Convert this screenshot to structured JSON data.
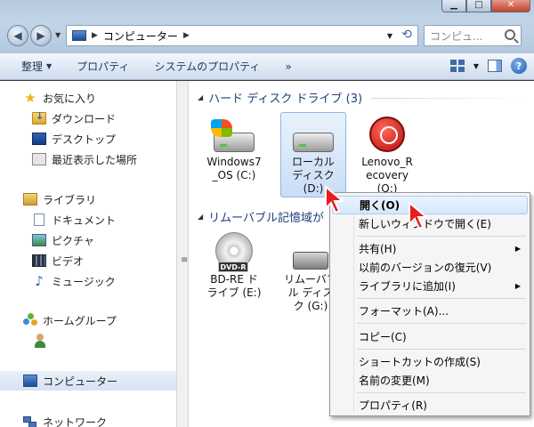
{
  "address": {
    "location": "コンピューター",
    "search_placeholder": "コンピュ..."
  },
  "window_controls": {
    "minimize": "▁",
    "maximize": "□",
    "close": "✕"
  },
  "toolbar": {
    "organize": "整理",
    "properties": "プロパティ",
    "system_properties": "システムのプロパティ",
    "more": "»",
    "help": "?"
  },
  "navpane": {
    "favorites": "お気に入り",
    "downloads": "ダウンロード",
    "desktop": "デスクトップ",
    "recent": "最近表示した場所",
    "libraries": "ライブラリ",
    "documents": "ドキュメント",
    "pictures": "ピクチャ",
    "videos": "ビデオ",
    "music": "ミュージック",
    "homegroup": "ホームグループ",
    "computer": "コンピューター",
    "network": "ネットワーク"
  },
  "content": {
    "hdd_group": "ハード ディスク ドライブ (3)",
    "removable_group": "リムーバブル記憶域が",
    "drives": [
      {
        "line1": "Windows7",
        "line2": "_OS (C:)"
      },
      {
        "line1": "ローカル",
        "line2": "ディスク",
        "line3": "(D:)"
      },
      {
        "line1": "Lenovo_R",
        "line2": "ecovery",
        "line3": "(Q:)"
      }
    ],
    "removable": [
      {
        "line1": "BD-RE ド",
        "line2": "ライブ (E:)",
        "badge": "DVD-R"
      },
      {
        "line1": "リムーバブ",
        "line2": "ル ディス",
        "line3": "ク (G:)"
      }
    ]
  },
  "context_menu": {
    "open": "開く(O)",
    "open_new_window": "新しいウィンドウで開く(E)",
    "share": "共有(H)",
    "restore_previous": "以前のバージョンの復元(V)",
    "add_to_library": "ライブラリに追加(I)",
    "format": "フォーマット(A)...",
    "copy": "コピー(C)",
    "create_shortcut": "ショートカットの作成(S)",
    "rename": "名前の変更(M)",
    "properties": "プロパティ(R)"
  }
}
